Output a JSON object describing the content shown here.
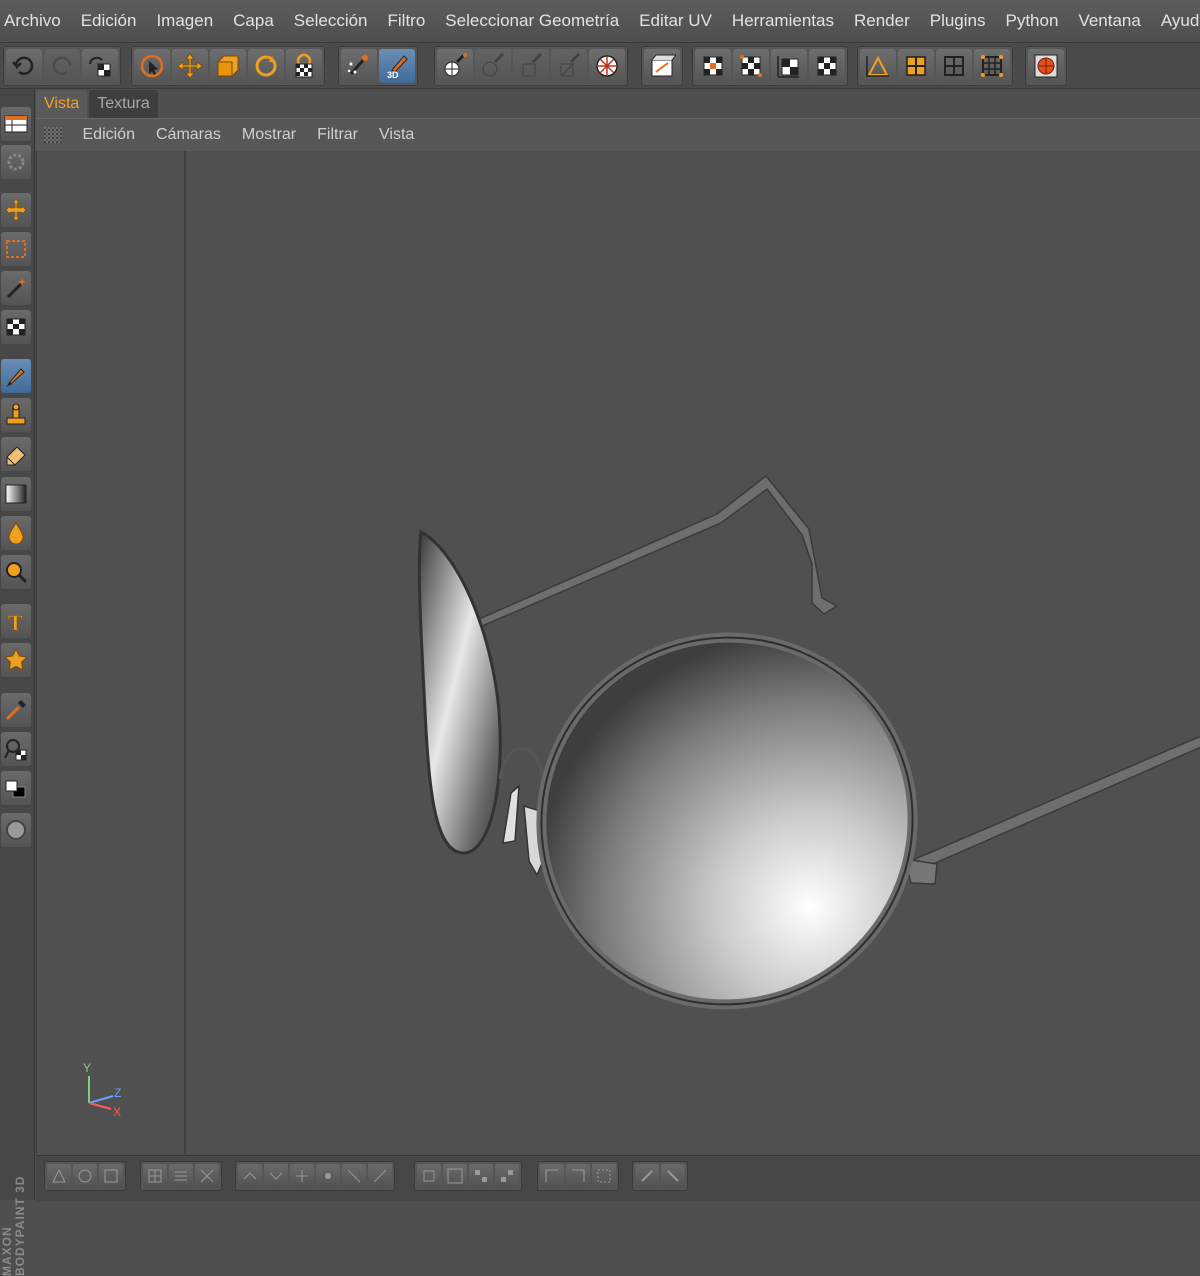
{
  "menu": [
    "Archivo",
    "Edición",
    "Imagen",
    "Capa",
    "Selección",
    "Filtro",
    "Seleccionar Geometría",
    "Editar UV",
    "Herramientas",
    "Render",
    "Plugins",
    "Python",
    "Ventana",
    "Ayuda"
  ],
  "tabs": {
    "active": "Vista",
    "inactive": "Textura"
  },
  "view_menu": [
    "Edición",
    "Cámaras",
    "Mostrar",
    "Filtrar",
    "Vista"
  ],
  "toolbar_icons": {
    "history": [
      "undo-icon",
      "redo-icon",
      "reset-icon"
    ],
    "transform": [
      "live-selection-icon",
      "move-icon",
      "scale-icon",
      "rotate-icon",
      "lock-texture-icon"
    ],
    "paint": [
      "paint-setup-wizard-icon",
      "paint-3d-icon"
    ],
    "projection": [
      "projection-paint-1-icon",
      "projection-paint-2-icon",
      "projection-paint-3-icon",
      "projection-paint-4-icon",
      "projection-sphere-icon"
    ],
    "uv": [
      "uv-mapping-icon"
    ],
    "display": [
      "checker-1-icon",
      "checker-2-icon",
      "checker-3-icon",
      "checker-4-icon"
    ],
    "modes": [
      "points-mode-icon",
      "edges-mode-icon",
      "polygons-mode-icon",
      "uv-mode-icon"
    ],
    "render": [
      "render-view-icon"
    ]
  },
  "left_tools": [
    "layout-icon",
    "gear-icon",
    "move-tool-icon",
    "rect-selection-icon",
    "magic-wand-icon",
    "transform-icon",
    "brush-icon",
    "stamp-icon",
    "eraser-icon",
    "gradient-icon",
    "smudge-icon",
    "magnify-icon",
    "text-tool-icon",
    "star-shape-icon",
    "eyedropper-icon",
    "clone-icon",
    "color-swatch-icon",
    "sphere-icon"
  ],
  "brand_line1": "MAXON",
  "brand_line2": "BODYPAINT 3D",
  "axes": {
    "y": "Y",
    "z": "Z",
    "x": "X"
  },
  "colors": {
    "accent": "#f0a020",
    "active_tool": "#3f6a98",
    "viewport_bg": "#505050",
    "axis_y": "#7fcf7f",
    "axis_z": "#6aa0ff",
    "axis_x": "#ff5a5a"
  }
}
